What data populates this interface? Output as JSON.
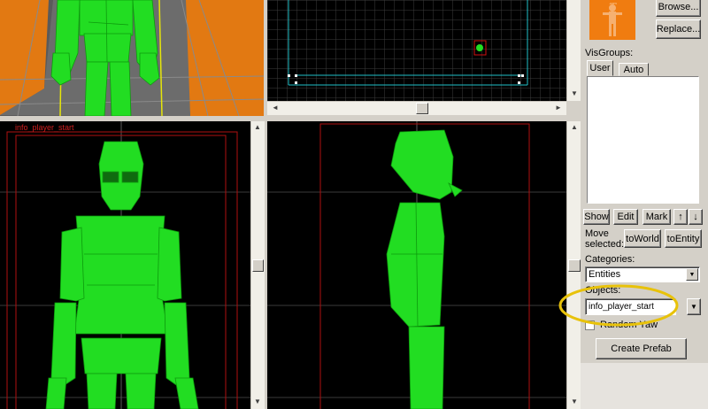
{
  "viewports": {
    "top_left_3d": "3d-perspective",
    "bottom_left_label": "info_player_start"
  },
  "browse_label": "Browse...",
  "replace_label": "Replace...",
  "visgroups": {
    "label": "VisGroups:",
    "tabs": [
      "User",
      "Auto"
    ]
  },
  "visgroup_buttons": {
    "show": "Show",
    "edit": "Edit",
    "mark": "Mark",
    "up": "↑",
    "down": "↓"
  },
  "move_selected": {
    "label_line1": "Move",
    "label_line2": "selected:",
    "to_world": "toWorld",
    "to_entity": "toEntity"
  },
  "categories": {
    "label": "Categories:",
    "value": "Entities"
  },
  "objects": {
    "label": "Objects:",
    "value": "info_player_start"
  },
  "random_yaw_label": "Random Yaw",
  "create_prefab_label": "Create Prefab",
  "colors": {
    "model_green": "#22dd22",
    "grid_red": "#b01010",
    "highlight_ellipse": "#e8c20a",
    "panel_bg": "#d4d0c8"
  }
}
